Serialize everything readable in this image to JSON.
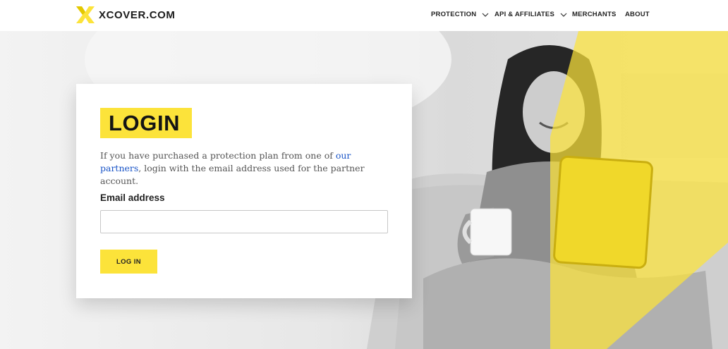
{
  "brand": {
    "name": "XCOVER.COM",
    "accent": "#fce33a",
    "link_color": "#1a55c7"
  },
  "nav": {
    "items": [
      {
        "label": "PROTECTION",
        "has_dropdown": true
      },
      {
        "label": "API & AFFILIATES",
        "has_dropdown": true
      },
      {
        "label": "MERCHANTS",
        "has_dropdown": false
      },
      {
        "label": "ABOUT",
        "has_dropdown": false
      }
    ]
  },
  "login": {
    "title": "LOGIN",
    "desc_before": "If you have purchased a protection plan from one of ",
    "desc_link": "our partners",
    "desc_after": ", login with the email address used for the partner account.",
    "email_label": "Email address",
    "email_value": "",
    "email_placeholder": "",
    "button_label": "LOG IN"
  },
  "hero": {
    "image_desc_icon": "woman-with-tablet-illustration"
  }
}
